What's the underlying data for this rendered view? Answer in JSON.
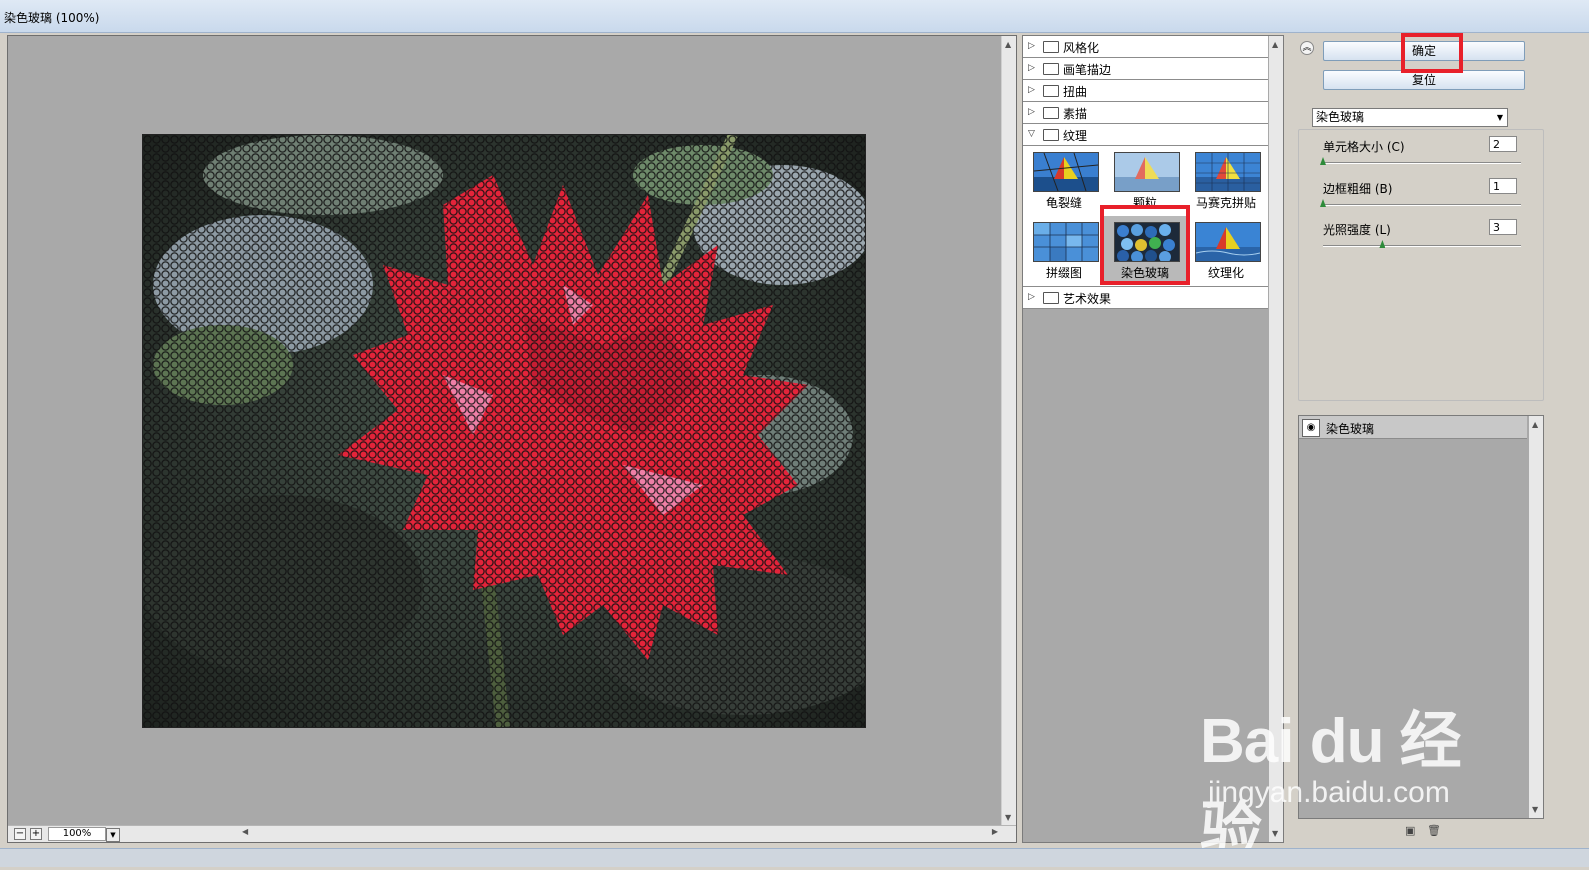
{
  "window": {
    "title": "染色玻璃 (100%)"
  },
  "preview": {
    "zoom": "100%",
    "zoom_out_label": "−",
    "zoom_in_label": "+"
  },
  "filters": {
    "categories_top": [
      {
        "label": "风格化",
        "expanded": false
      },
      {
        "label": "画笔描边",
        "expanded": false
      },
      {
        "label": "扭曲",
        "expanded": false
      },
      {
        "label": "素描",
        "expanded": false
      },
      {
        "label": "纹理",
        "expanded": true
      }
    ],
    "texture_items": [
      {
        "label": "龟裂缝"
      },
      {
        "label": "颗粒"
      },
      {
        "label": "马赛克拼贴"
      },
      {
        "label": "拼缀图"
      },
      {
        "label": "染色玻璃",
        "selected": true
      },
      {
        "label": "纹理化"
      }
    ],
    "categories_bottom": [
      {
        "label": "艺术效果",
        "expanded": false
      }
    ]
  },
  "controls": {
    "ok_label": "确定",
    "reset_label": "复位",
    "filter_select": "染色玻璃",
    "params": [
      {
        "label": "单元格大小 (C)",
        "value": "2",
        "level": 0.0
      },
      {
        "label": "边框粗细 (B)",
        "value": "1",
        "level": 0.0
      },
      {
        "label": "光照强度 (L)",
        "value": "3",
        "level": 0.3
      }
    ]
  },
  "layers": {
    "items": [
      {
        "label": "染色玻璃"
      }
    ]
  },
  "watermark": {
    "brand": "Bai du 经验",
    "url": "jingyan.baidu.com"
  },
  "colors": {
    "highlight": "#e8202a",
    "petal": "#e3243a",
    "leaf": "#3d4a3c"
  }
}
